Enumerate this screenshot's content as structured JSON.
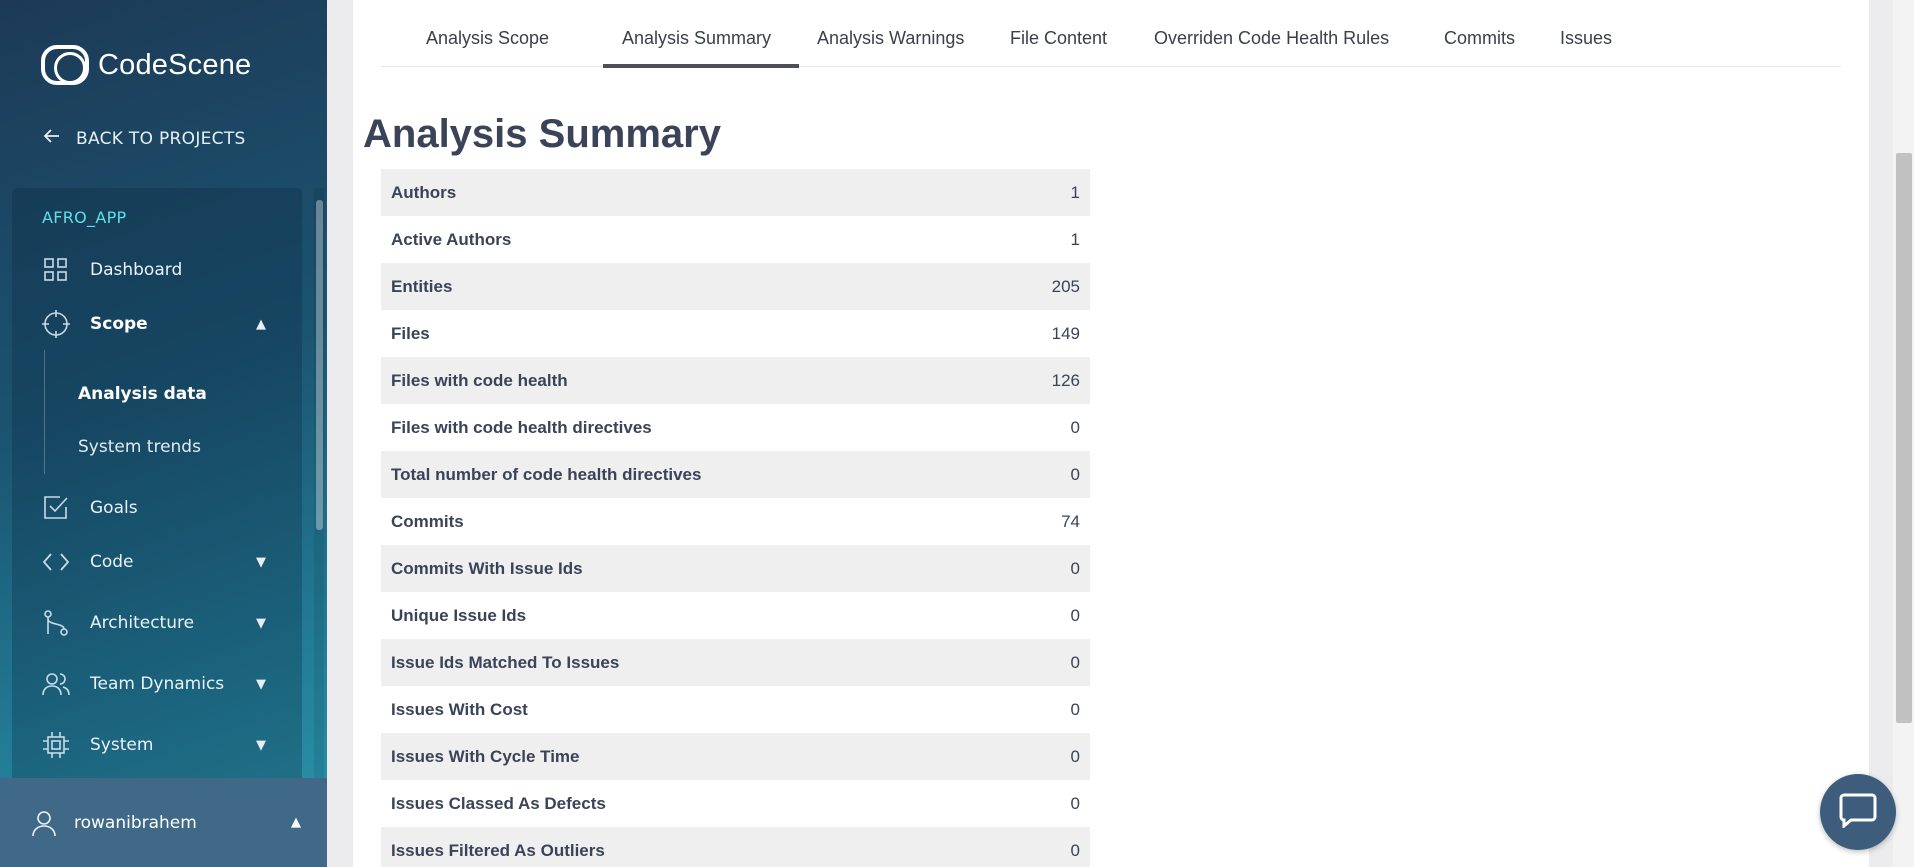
{
  "brand": {
    "name": "CodeScene"
  },
  "sidebar": {
    "back_label": "BACK TO PROJECTS",
    "project": "AFRO_APP",
    "items": [
      {
        "label": "Dashboard"
      },
      {
        "label": "Scope"
      },
      {
        "label": "Goals"
      },
      {
        "label": "Code"
      },
      {
        "label": "Architecture"
      },
      {
        "label": "Team Dynamics"
      },
      {
        "label": "System"
      }
    ],
    "sub_items": [
      {
        "label": "Analysis data"
      },
      {
        "label": "System trends"
      }
    ],
    "user": "rowanibrahem"
  },
  "tabs": [
    {
      "label": "Analysis Scope"
    },
    {
      "label": "Analysis Summary"
    },
    {
      "label": "Analysis Warnings"
    },
    {
      "label": "File Content"
    },
    {
      "label": "Overriden Code Health Rules"
    },
    {
      "label": "Commits"
    },
    {
      "label": "Issues"
    }
  ],
  "active_tab": "Analysis Summary",
  "page_title": "Analysis Summary",
  "summary": [
    {
      "key": "Authors",
      "value": "1"
    },
    {
      "key": "Active Authors",
      "value": "1"
    },
    {
      "key": "Entities",
      "value": "205"
    },
    {
      "key": "Files",
      "value": "149"
    },
    {
      "key": "Files with code health",
      "value": "126"
    },
    {
      "key": "Files with code health directives",
      "value": "0"
    },
    {
      "key": "Total number of code health directives",
      "value": "0"
    },
    {
      "key": "Commits",
      "value": "74"
    },
    {
      "key": "Commits With Issue Ids",
      "value": "0"
    },
    {
      "key": "Unique Issue Ids",
      "value": "0"
    },
    {
      "key": "Issue Ids Matched To Issues",
      "value": "0"
    },
    {
      "key": "Issues With Cost",
      "value": "0"
    },
    {
      "key": "Issues With Cycle Time",
      "value": "0"
    },
    {
      "key": "Issues Classed As Defects",
      "value": "0"
    },
    {
      "key": "Issues Filtered As Outliers",
      "value": "0"
    }
  ],
  "icons": {
    "back": "arrow-left-icon",
    "dashboard": "grid-icon",
    "scope": "crosshair-icon",
    "goals": "checkbox-icon",
    "code": "code-brackets-icon",
    "architecture": "branch-icon",
    "team": "users-icon",
    "system": "chip-icon",
    "user": "user-icon",
    "chat": "chat-bubble-icon"
  },
  "colors": {
    "accent": "#5de0e6",
    "sidebar_start": "#1c3a57",
    "sidebar_end": "#2d97ad",
    "title_text": "#3a4357",
    "row_stripe": "#efefef"
  }
}
